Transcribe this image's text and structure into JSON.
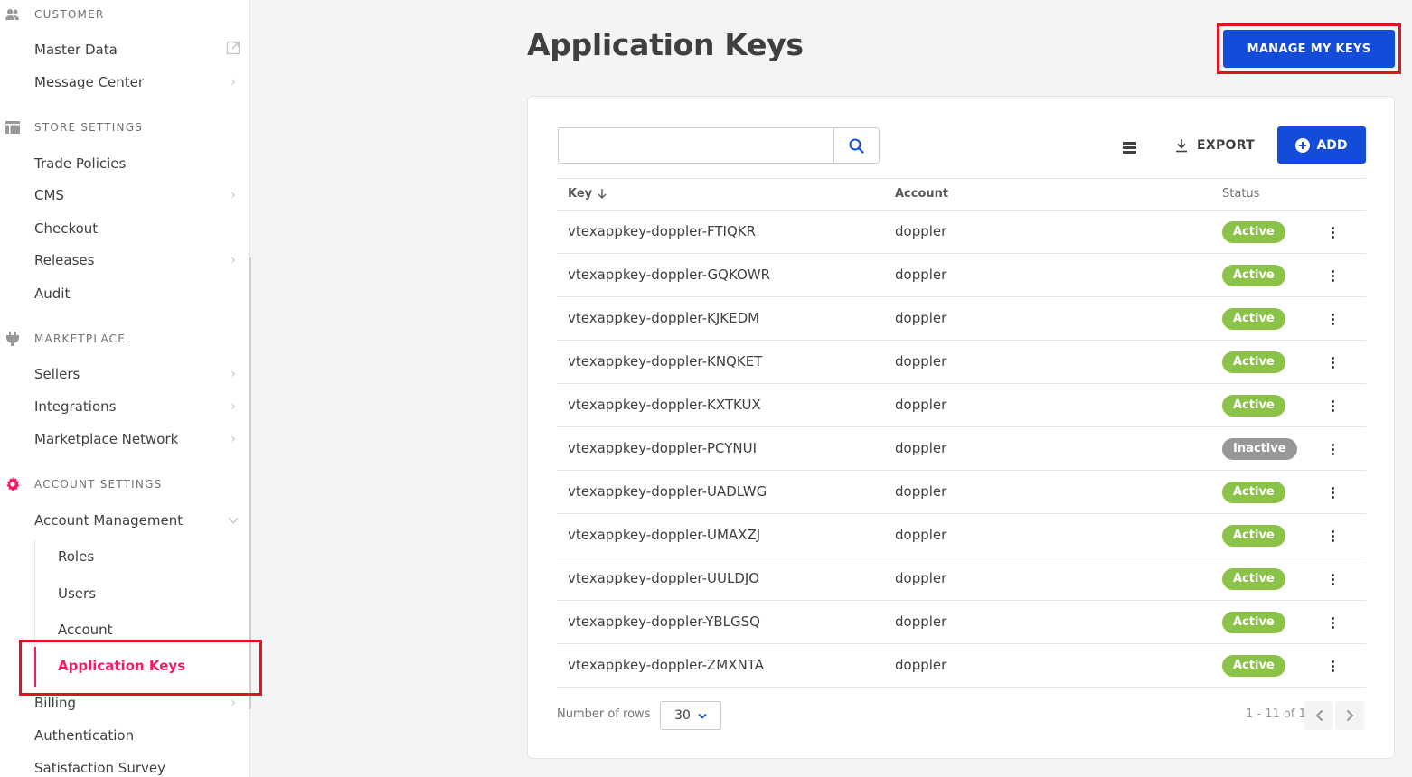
{
  "sidebar": {
    "sections": {
      "customer": {
        "title": "CUSTOMER",
        "icon": "users-icon"
      },
      "store": {
        "title": "STORE SETTINGS",
        "icon": "layout-icon"
      },
      "marketplace": {
        "title": "MARKETPLACE",
        "icon": "plug-icon"
      },
      "account": {
        "title": "ACCOUNT SETTINGS",
        "icon": "gear-icon"
      }
    },
    "items": {
      "master_data": "Master Data",
      "message_center": "Message Center",
      "trade_policies": "Trade Policies",
      "cms": "CMS",
      "checkout": "Checkout",
      "releases": "Releases",
      "audit": "Audit",
      "sellers": "Sellers",
      "integrations": "Integrations",
      "marketplace_network": "Marketplace Network",
      "account_management": "Account Management",
      "roles": "Roles",
      "users": "Users",
      "account": "Account",
      "application_keys": "Application Keys",
      "billing": "Billing",
      "authentication": "Authentication",
      "satisfaction_survey": "Satisfaction Survey"
    },
    "accent_color": "#f71963"
  },
  "header": {
    "title": "Application Keys",
    "manage_button": "MANAGE MY KEYS"
  },
  "toolbar": {
    "search_value": "",
    "export_label": "EXPORT",
    "add_label": "ADD"
  },
  "table": {
    "columns": {
      "key": "Key",
      "account": "Account",
      "status": "Status"
    },
    "rows": [
      {
        "key": "vtexappkey-doppler-FTIQKR",
        "account": "doppler",
        "status": "Active"
      },
      {
        "key": "vtexappkey-doppler-GQKOWR",
        "account": "doppler",
        "status": "Active"
      },
      {
        "key": "vtexappkey-doppler-KJKEDM",
        "account": "doppler",
        "status": "Active"
      },
      {
        "key": "vtexappkey-doppler-KNQKET",
        "account": "doppler",
        "status": "Active"
      },
      {
        "key": "vtexappkey-doppler-KXTKUX",
        "account": "doppler",
        "status": "Active"
      },
      {
        "key": "vtexappkey-doppler-PCYNUI",
        "account": "doppler",
        "status": "Inactive"
      },
      {
        "key": "vtexappkey-doppler-UADLWG",
        "account": "doppler",
        "status": "Active"
      },
      {
        "key": "vtexappkey-doppler-UMAXZJ",
        "account": "doppler",
        "status": "Active"
      },
      {
        "key": "vtexappkey-doppler-UULDJO",
        "account": "doppler",
        "status": "Active"
      },
      {
        "key": "vtexappkey-doppler-YBLGSQ",
        "account": "doppler",
        "status": "Active"
      },
      {
        "key": "vtexappkey-doppler-ZMXNTA",
        "account": "doppler",
        "status": "Active"
      }
    ]
  },
  "footer": {
    "rows_label": "Number of rows",
    "rows_value": "30",
    "pagination": "1 - 11 of 11"
  },
  "colors": {
    "primary": "#134cd8",
    "active_badge": "#8bc34a",
    "inactive_badge": "#979899",
    "highlight": "#e1131c"
  }
}
